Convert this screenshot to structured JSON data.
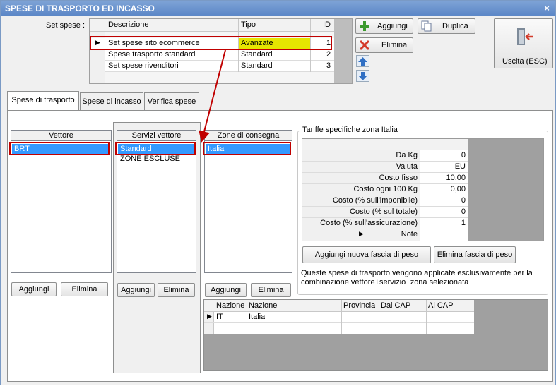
{
  "window": {
    "title": "SPESE DI TRASPORTO ED INCASSO",
    "close_glyph": "×"
  },
  "set_spese": {
    "label": "Set spese :",
    "columns": [
      "Descrizione",
      "Tipo",
      "ID"
    ],
    "rows": [
      {
        "descrizione": "Set spese sito ecommerce",
        "tipo": "Avanzate",
        "id": "1"
      },
      {
        "descrizione": "Spese trasporto standard",
        "tipo": "Standard",
        "id": "2"
      },
      {
        "descrizione": "Set spese rivenditori",
        "tipo": "Standard",
        "id": "3"
      }
    ],
    "current_row_marker": "▶"
  },
  "toolbar": {
    "aggiungi": "Aggiungi",
    "duplica": "Duplica",
    "elimina": "Elimina",
    "uscita": "Uscita (ESC)"
  },
  "tabs": [
    "Spese di trasporto",
    "Spese di incasso",
    "Verifica spese"
  ],
  "vettore": {
    "header": "Vettore",
    "items": [
      "BRT"
    ],
    "add": "Aggiungi",
    "remove": "Elimina"
  },
  "servizi": {
    "header": "Servizi vettore",
    "items": [
      "Standard",
      "ZONE ESCLUSE"
    ],
    "add": "Aggiungi",
    "remove": "Elimina"
  },
  "zone": {
    "header": "Zone di consegna",
    "items": [
      "Italia"
    ],
    "add": "Aggiungi",
    "remove": "Elimina"
  },
  "tariffe": {
    "legend": "Tariffe specifiche zona Italia",
    "rows": [
      {
        "label": "Da Kg",
        "value": "0"
      },
      {
        "label": "Valuta",
        "value": "EU"
      },
      {
        "label": "Costo fisso",
        "value": "10,00"
      },
      {
        "label": "Costo ogni 100 Kg",
        "value": "0,00"
      },
      {
        "label": "Costo (% sull'imponibile)",
        "value": "0"
      },
      {
        "label": "Costo (% sul totale)",
        "value": "0"
      },
      {
        "label": "Costo (% sull'assicurazione)",
        "value": "1"
      },
      {
        "label": "Note",
        "value": ""
      }
    ],
    "add_band": "Aggiungi nuova fascia di peso",
    "remove_band": "Elimina fascia di peso",
    "info": "Queste spese di trasporto vengono applicate esclusivamente per la combinazione vettore+servizio+zona selezionata"
  },
  "nazioni": {
    "columns": [
      "Nazione",
      "Nazione",
      "Provincia",
      "Dal CAP",
      "Al CAP"
    ],
    "rows": [
      {
        "code": "IT",
        "name": "Italia",
        "provincia": "",
        "dal": "",
        "al": ""
      }
    ]
  },
  "colors": {
    "title_bar": "#5c87c7",
    "selection": "#3399ff",
    "highlight_tipo": "#e6e600",
    "annotation": "#c00000"
  }
}
